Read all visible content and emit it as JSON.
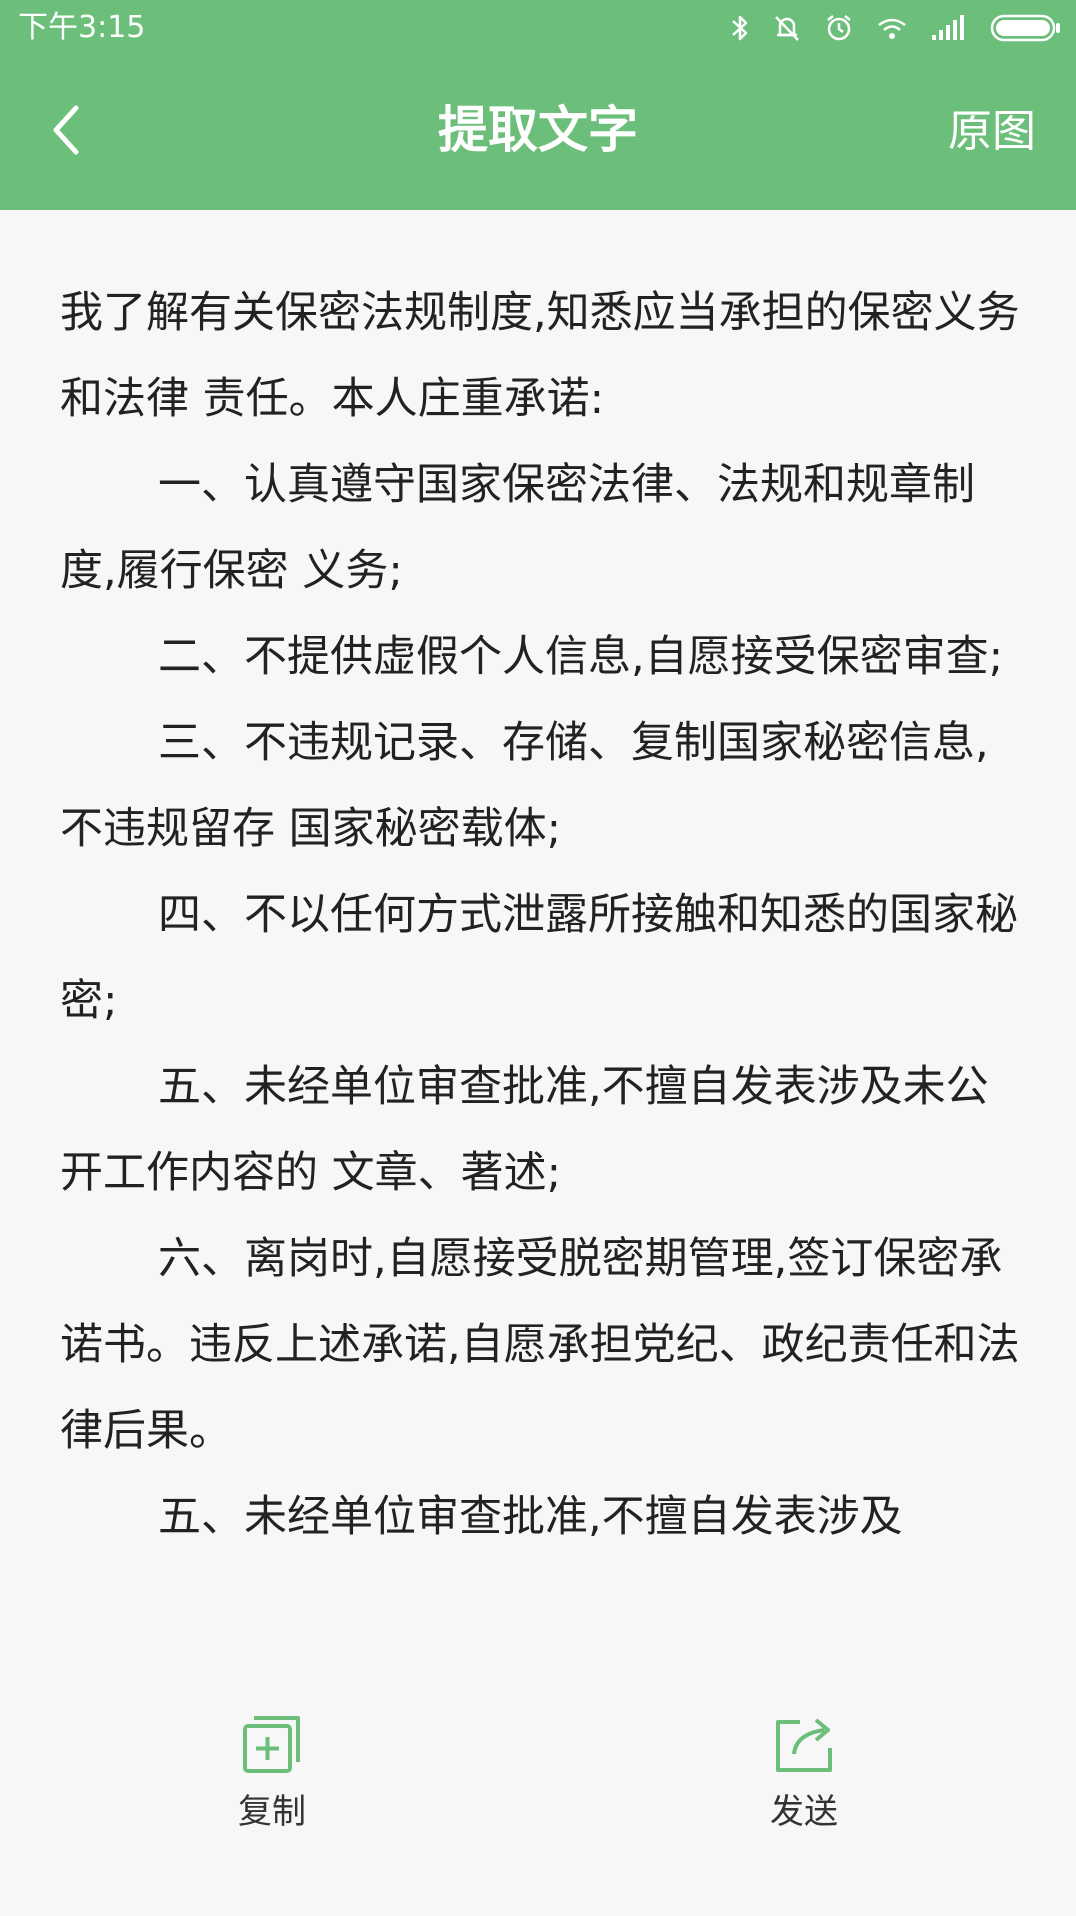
{
  "status_bar": {
    "time": "下午3:15",
    "icons": [
      "bluetooth-icon",
      "mute-icon",
      "alarm-icon",
      "wifi-icon",
      "signal-icon",
      "battery-icon"
    ]
  },
  "app_bar": {
    "back_icon": "chevron-left-icon",
    "title": "提取文字",
    "original_label": "原图",
    "color": "#6cbf7a"
  },
  "content": {
    "paragraphs": [
      "我了解有关保密法规制度,知悉应当承担的保密义务和法律 责任。本人庄重承诺:",
      "一、认真遵守国家保密法律、法规和规章制度,履行保密 义务;",
      "二、不提供虚假个人信息,自愿接受保密审查;",
      "三、不违规记录、存储、复制国家秘密信息,不违规留存 国家秘密载体;",
      "四、不以任何方式泄露所接触和知悉的国家秘密;",
      "五、未经单位审查批准,不擅自发表涉及未公开工作内容的 文章、著述;",
      "六、离岗时,自愿接受脱密期管理,签订保密承诺书。违反上述承诺,自愿承担党纪、政纪责任和法律后果。",
      "五、未经单位审查批准,不擅自发表涉及"
    ]
  },
  "bottom_bar": {
    "copy_label": "复制",
    "copy_icon": "copy-icon",
    "send_label": "发送",
    "send_icon": "share-icon",
    "accent": "#6cbf7a"
  }
}
